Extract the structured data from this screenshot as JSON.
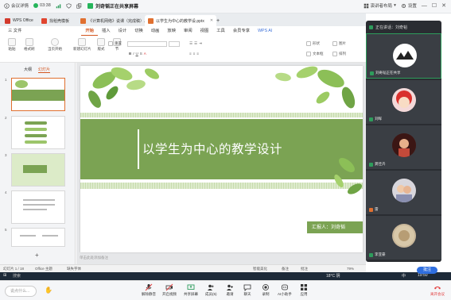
{
  "meeting_bar": {
    "info_label": "会议详情",
    "timer": "03:38",
    "share_status": "刘奇韬正在共享屏幕",
    "layout_label": "演讲者布局",
    "settings_label": "设置"
  },
  "wps_tabs": [
    {
      "label": "WPS Office"
    },
    {
      "label": "找稻壳模板"
    },
    {
      "label": "《计算机网络》说课（完成稿）.pptx"
    },
    {
      "label": "以学生为中心的教学设.pptx"
    }
  ],
  "ribbon": {
    "file_label": "三 文件",
    "menus": [
      "开始",
      "插入",
      "设计",
      "切换",
      "动画",
      "放映",
      "审阅",
      "视图",
      "工具",
      "会员专享",
      "WPS AI"
    ],
    "active_menu": "开始",
    "tools": {
      "format_painter": "格式刷",
      "paste": "粘贴",
      "current_start": "当页开始",
      "new_slide": "新建幻灯片",
      "layout": "版式",
      "section": "节",
      "reset": "重置",
      "shape": "形状",
      "picture": "图片",
      "textbox": "文本框",
      "arrange": "排列"
    }
  },
  "left_panel": {
    "tabs": [
      "大纲",
      "幻灯片"
    ],
    "active_tab": "幻灯片",
    "slide_numbers": [
      "1",
      "2",
      "3",
      "4",
      "5"
    ],
    "add_symbol": "+"
  },
  "slide": {
    "title": "以学生为中心的教学设计",
    "presenter": "汇报人：刘奇韬",
    "notes_placeholder": "单击此处添加备注"
  },
  "status_bar": {
    "slide_count": "幻灯片 1 / 18",
    "theme": "Office 主题",
    "font_missing": "缺失字体",
    "smart_beautify": "智能美化",
    "notes": "备注",
    "comments": "批注",
    "zoom": "79%"
  },
  "taskbar": {
    "search": "搜索",
    "temp": "18°C 阴",
    "lang": "中",
    "time": "19:50"
  },
  "meeting_toolbar": {
    "chat_placeholder": "说点什么...",
    "buttons": [
      "解除静音",
      "开启视频",
      "共享屏幕",
      "成员(5)",
      "邀请",
      "聊天",
      "录制",
      "AI小助手",
      "应用"
    ],
    "end_label": "离开会议"
  },
  "video_panel": {
    "speaking_label": "正在讲话：刘奇韬",
    "participants": [
      {
        "name": "刘奇韬正在共享"
      },
      {
        "name": "刘晖"
      },
      {
        "name": "龚佳卉"
      },
      {
        "name": "雷"
      },
      {
        "name": "李亚豪"
      }
    ],
    "annotate_label": "批注"
  },
  "colors": {
    "accent": "#d3551f",
    "slide_green": "#7ba353",
    "meeting_green": "#2e9c5c"
  }
}
